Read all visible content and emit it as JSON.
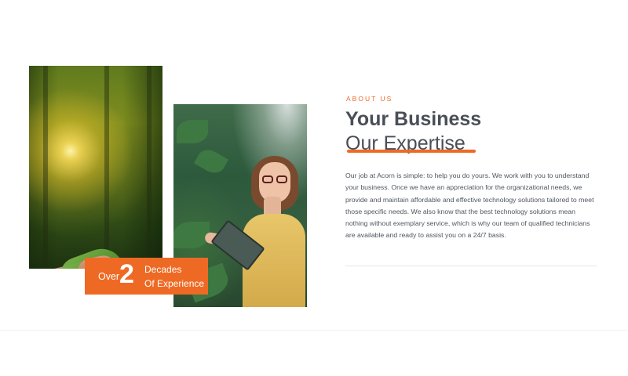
{
  "images": {
    "forest_hands": "photo-hands-exchanging-seedling-in-forest",
    "woman_tablet": "photo-woman-with-tablet-in-greenhouse"
  },
  "badge": {
    "prefix": "Over",
    "number": "2",
    "line1": "Decades",
    "line2": "Of Experience"
  },
  "about": {
    "eyebrow": "ABOUT US",
    "heading_bold": "Your Business",
    "heading_light": "Our Expertise",
    "body": "Our job at Acorn is simple: to help you do yours. We work with you to understand your business. Once we have an appreciation for the organizational needs, we provide and maintain affordable and effective technology solutions tailored to meet those specific needs. We also know that the best technology solutions mean nothing without exemplary service, which is why our team of qualified technicians are available and ready to assist you on a 24/7 basis."
  },
  "colors": {
    "accent": "#ee6a24",
    "heading": "#4a4e57",
    "body_text": "#4f5560"
  }
}
